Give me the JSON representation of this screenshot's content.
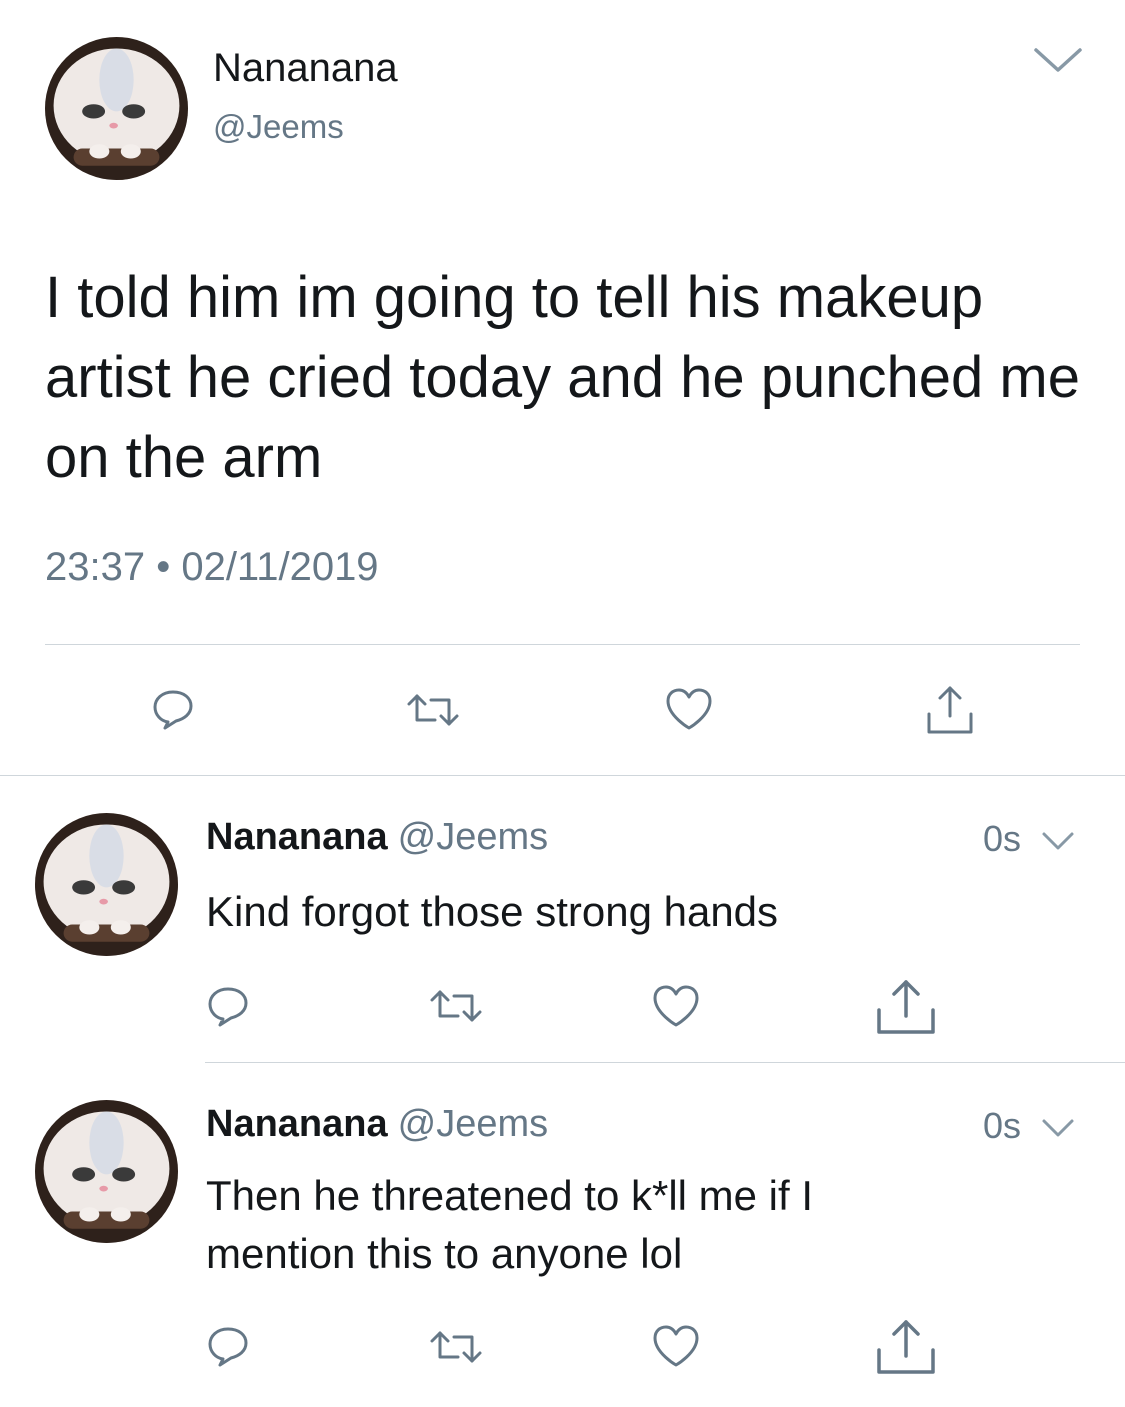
{
  "main_tweet": {
    "display_name": "Nananana",
    "handle": "@Jeems",
    "text": "I told him im going to tell his makeup artist he cried today and he punched me on the arm",
    "timestamp": "23:37 • 02/11/2019"
  },
  "replies": [
    {
      "display_name": "Nananana",
      "handle": "@Jeems",
      "time": "0s",
      "text": "Kind forgot those strong hands"
    },
    {
      "display_name": "Nananana",
      "handle": "@Jeems",
      "time": "0s",
      "text": "Then he threatened to k*ll me if I mention this to anyone lol"
    }
  ],
  "icons": {
    "reply": "reply-icon",
    "retweet": "retweet-icon",
    "like": "heart-icon",
    "share": "share-icon",
    "menu": "chevron-down-icon"
  },
  "colors": {
    "text": "#14171a",
    "secondary": "#657786",
    "icon": "#657786",
    "divider": "#cfd6db"
  }
}
